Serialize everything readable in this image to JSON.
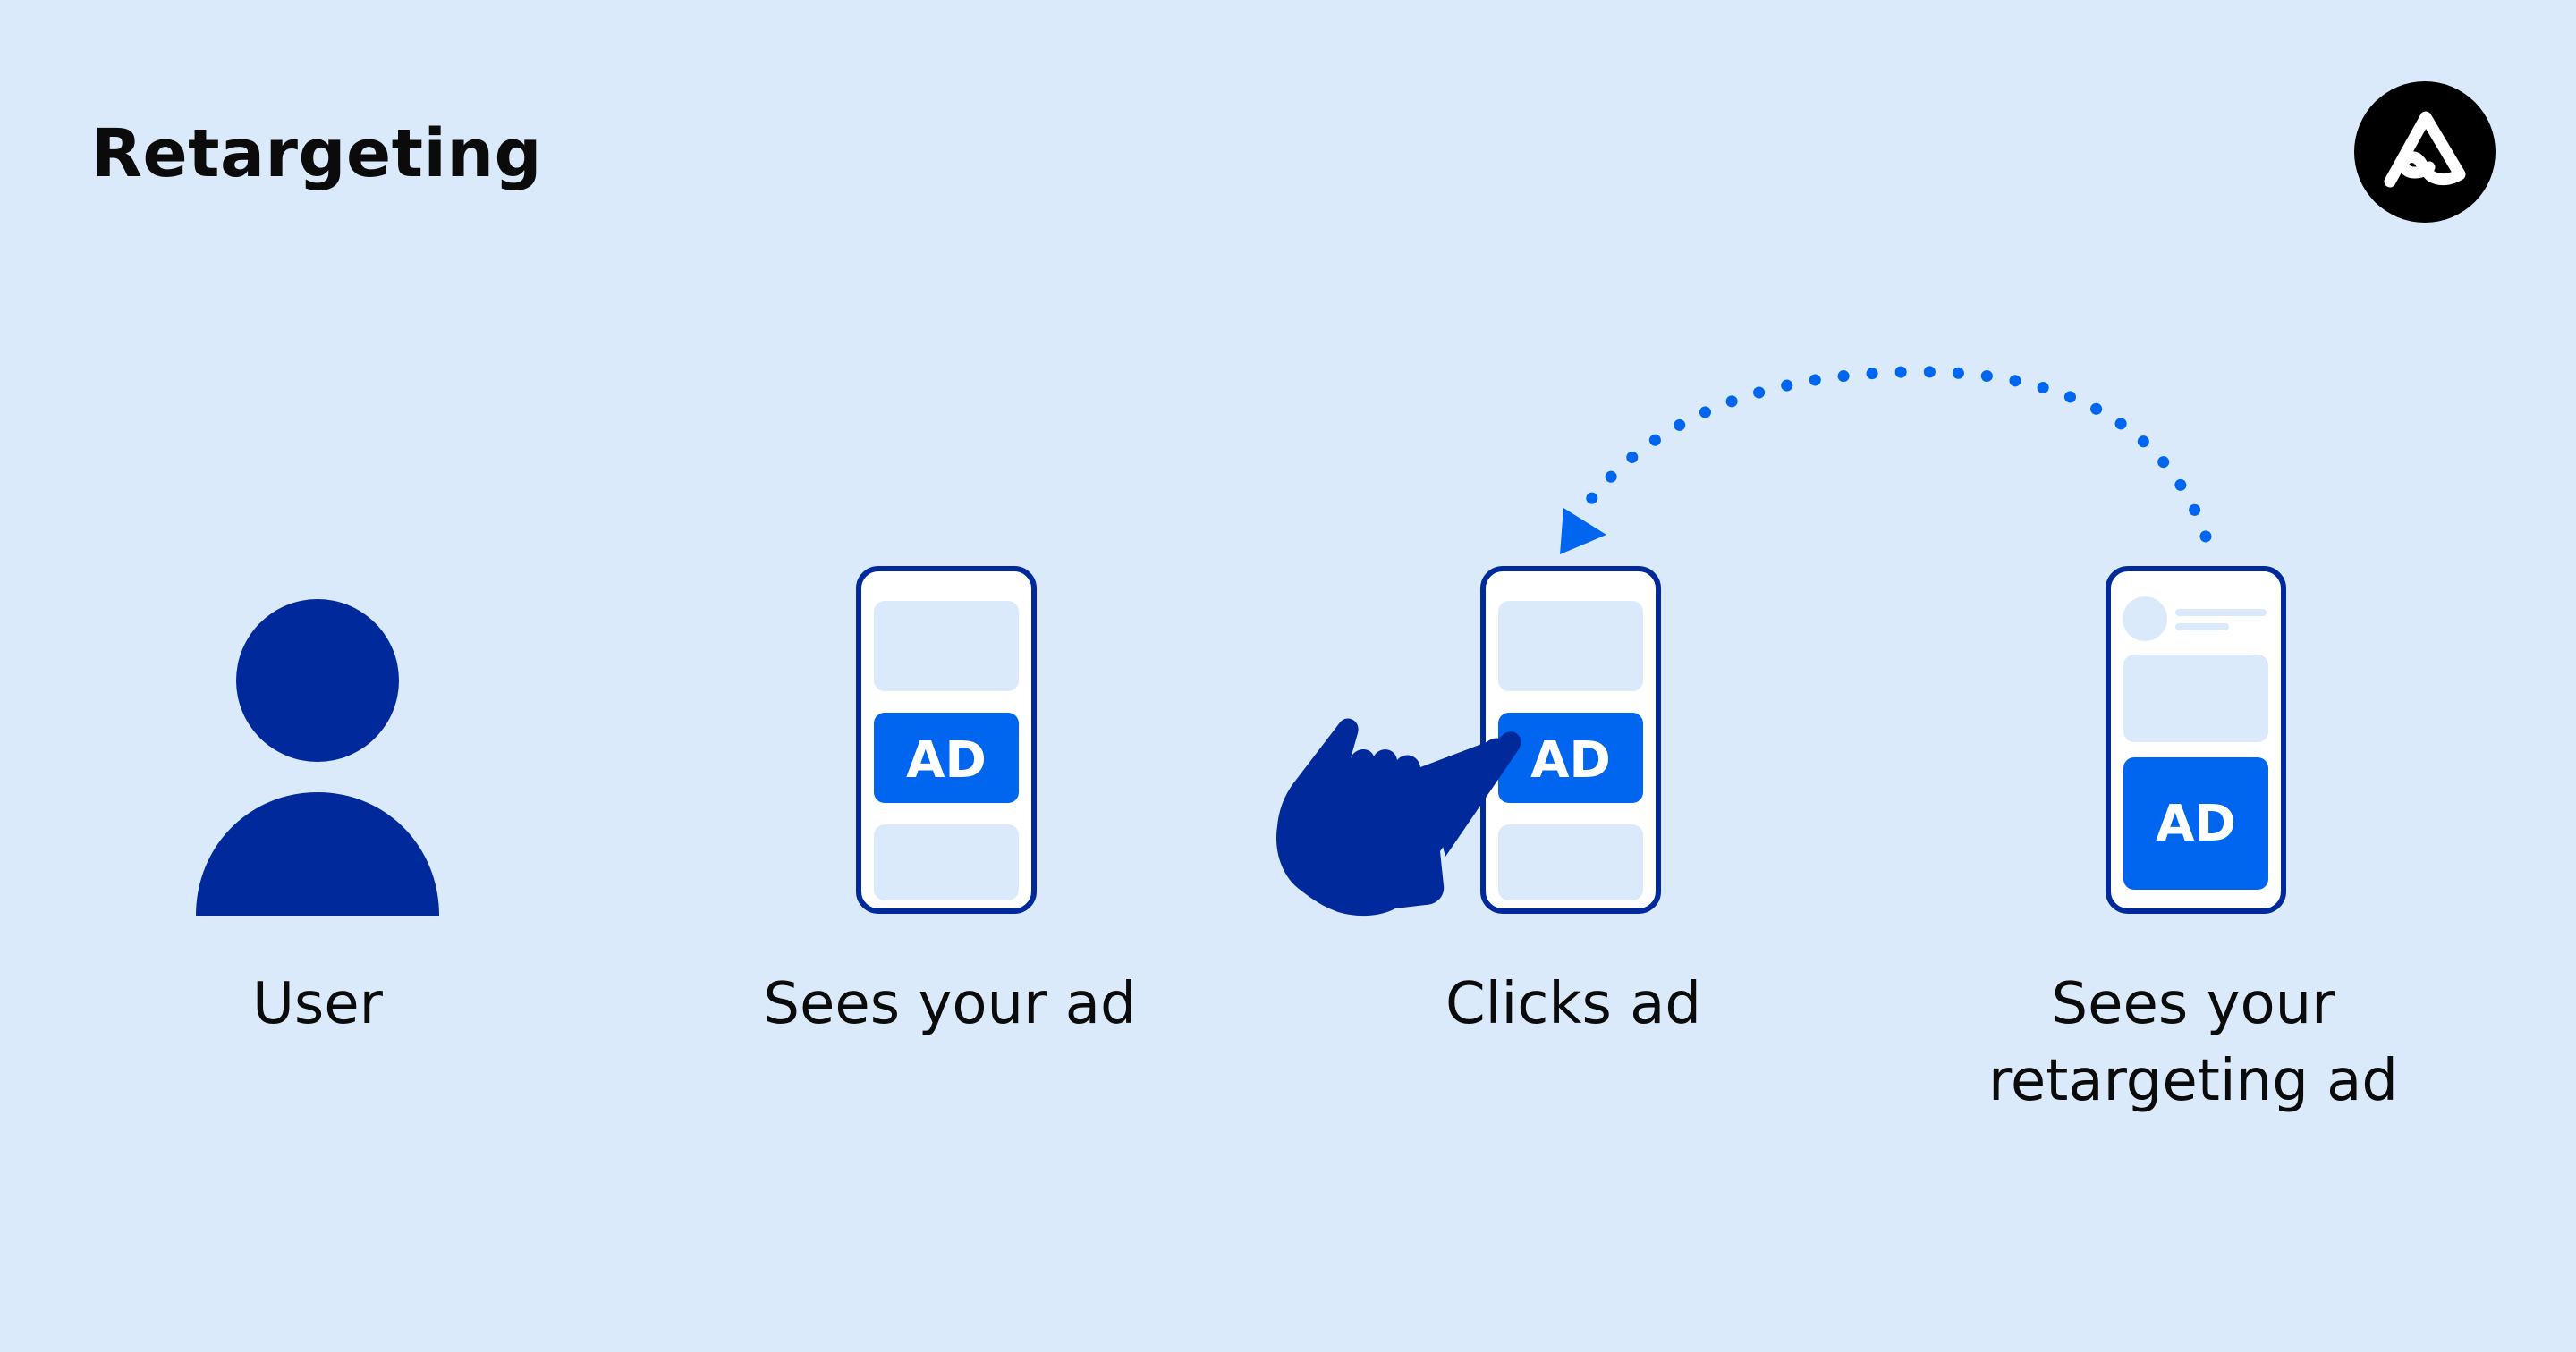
{
  "title": "Retargeting",
  "logo": {
    "icon": "brand-a-icon"
  },
  "steps": [
    {
      "label": "User",
      "icon": "user-icon"
    },
    {
      "label": "Sees your ad",
      "icon": "phone-icon",
      "ad_label": "AD"
    },
    {
      "label": "Clicks ad",
      "icon": "phone-icon",
      "ad_label": "AD",
      "pointer_icon": "hand-pointer-icon"
    },
    {
      "label_line1": "Sees your",
      "label_line2": "retargeting ad",
      "icon": "phone-icon",
      "ad_label": "AD"
    }
  ],
  "connector": {
    "style": "dotted",
    "icon": "arrow-head-icon",
    "from": "step-4",
    "to": "step-3"
  },
  "colors": {
    "background": "#dbeafa",
    "navy": "#002a9c",
    "accent_blue": "#0066f0",
    "screen_block": "#dbeafa",
    "text": "#0b0b0b"
  }
}
